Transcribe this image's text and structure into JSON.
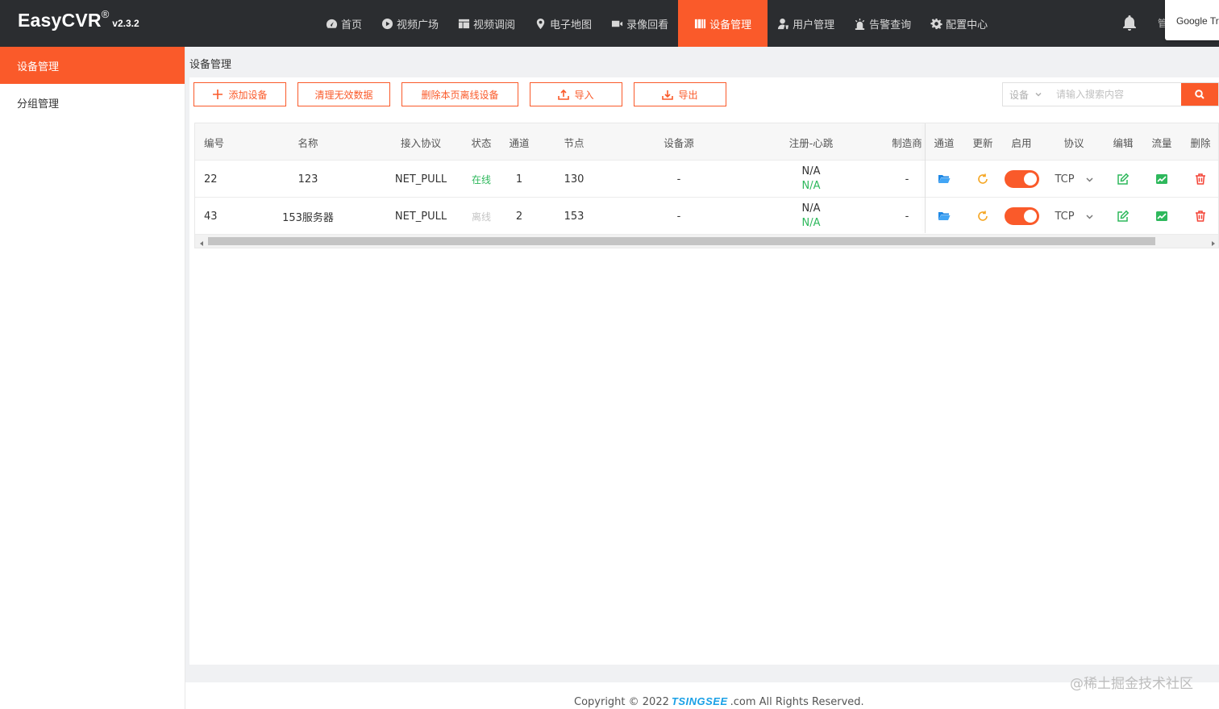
{
  "app": {
    "name": "EasyCVR",
    "reg": "®",
    "version": "v2.3.2"
  },
  "nav": [
    {
      "label": "首页",
      "icon": "dashboard-icon"
    },
    {
      "label": "视频广场",
      "icon": "play-icon"
    },
    {
      "label": "视频调阅",
      "icon": "layout-icon"
    },
    {
      "label": "电子地图",
      "icon": "map-pin-icon"
    },
    {
      "label": "录像回看",
      "icon": "video-camera-icon"
    },
    {
      "label": "设备管理",
      "icon": "device-icon",
      "active": true
    },
    {
      "label": "用户管理",
      "icon": "user-icon"
    },
    {
      "label": "告警查询",
      "icon": "alarm-icon"
    },
    {
      "label": "配置中心",
      "icon": "gear-icon"
    }
  ],
  "nav_clip": "管",
  "google_translate": "Google Translate",
  "sidebar": {
    "items": [
      {
        "label": "设备管理",
        "active": true
      },
      {
        "label": "分组管理"
      }
    ]
  },
  "breadcrumb": "设备管理",
  "toolbar": {
    "add": "添加设备",
    "clean": "清理无效数据",
    "delete_offline": "删除本页离线设备",
    "import": "导入",
    "export": "导出"
  },
  "search": {
    "select": "设备",
    "placeholder": "请输入搜索内容"
  },
  "table": {
    "headers": [
      "编号",
      "名称",
      "接入协议",
      "状态",
      "通道",
      "节点",
      "设备源",
      "注册-心跳",
      "制造商",
      "通道",
      "更新",
      "启用",
      "协议",
      "编辑",
      "流量",
      "删除"
    ],
    "rows": [
      {
        "id": "22",
        "name": "123",
        "protocol": "NET_PULL",
        "status": "在线",
        "online": true,
        "channels": "1",
        "node": "130",
        "source": "-",
        "register": "N/A",
        "heartbeat": "N/A",
        "maker": "-",
        "transport": "TCP",
        "enabled": true
      },
      {
        "id": "43",
        "name": "153服务器",
        "protocol": "NET_PULL",
        "status": "离线",
        "online": false,
        "channels": "2",
        "node": "153",
        "source": "-",
        "register": "N/A",
        "heartbeat": "N/A",
        "maker": "-",
        "transport": "TCP",
        "enabled": true
      }
    ]
  },
  "footer": {
    "prefix": "Copyright © 2022",
    "brand": "TSINGSEE",
    "suffix": ".com All Rights Reserved."
  },
  "watermark": "@稀土掘金技术社区",
  "colors": {
    "accent": "#fa5a2a",
    "online": "#2eb85c",
    "topbar": "#2b2d30",
    "link": "#1aa0e6"
  }
}
